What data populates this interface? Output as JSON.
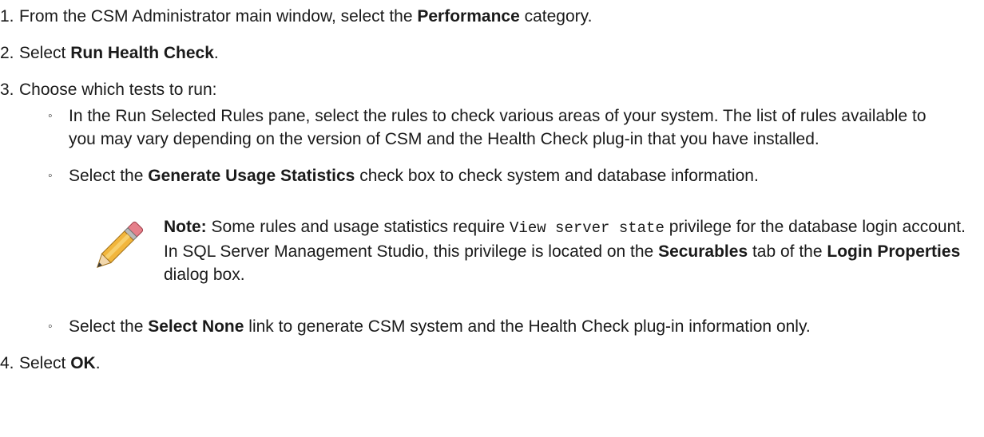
{
  "steps": [
    {
      "num": "1.",
      "pre": "From the CSM Administrator main window, select the ",
      "bold": "Performance",
      "post": " category."
    },
    {
      "num": "2.",
      "pre": "Select ",
      "bold": "Run Health Check",
      "post": "."
    },
    {
      "num": "3.",
      "text": "Choose which tests to run:",
      "sub": [
        {
          "text": "In the Run Selected Rules pane, select the rules to check various areas of your system. The list of rules available to you may vary depending on the version of CSM and the Health Check plug-in that you have installed."
        },
        {
          "pre": "Select the ",
          "bold": "Generate Usage Statistics",
          "post": " check box to check system and database information."
        },
        {
          "pre": "Select the ",
          "bold": "Select None",
          "post": " link to generate CSM system and the Health Check plug-in information only."
        }
      ]
    },
    {
      "num": "4.",
      "pre": "Select ",
      "bold": "OK",
      "post": "."
    }
  ],
  "note": {
    "label": "Note:",
    "t1": " Some rules and usage statistics require ",
    "code": "View server state",
    "t2": " privilege for the database login account. In SQL Server Management Studio, this privilege is located on the ",
    "b1": "Securables",
    "t3": " tab of the ",
    "b2": "Login Properties",
    "t4": " dialog box.",
    "icon": "pencil-icon"
  },
  "bullet_glyph": "◦"
}
